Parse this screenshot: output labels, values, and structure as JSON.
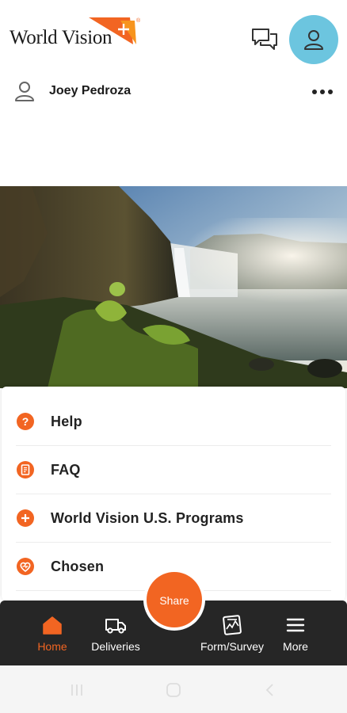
{
  "brand": {
    "name": "World Vision",
    "accent_color": "#f26522"
  },
  "header": {
    "chat_icon": "chat-bubbles-icon",
    "avatar_icon": "user-avatar-icon",
    "avatar_color": "#6cc5df"
  },
  "user": {
    "name": "Joey Pedroza",
    "more_icon": "more-dots-icon"
  },
  "menu": {
    "items": [
      {
        "label": "Help",
        "icon": "help-icon"
      },
      {
        "label": "FAQ",
        "icon": "faq-icon"
      },
      {
        "label": "World Vision U.S. Programs",
        "icon": "programs-icon"
      },
      {
        "label": "Chosen",
        "icon": "chosen-heart-icon"
      }
    ]
  },
  "nav": {
    "home": "Home",
    "deliveries": "Deliveries",
    "share": "Share",
    "form_survey": "Form/Survey",
    "more": "More"
  }
}
